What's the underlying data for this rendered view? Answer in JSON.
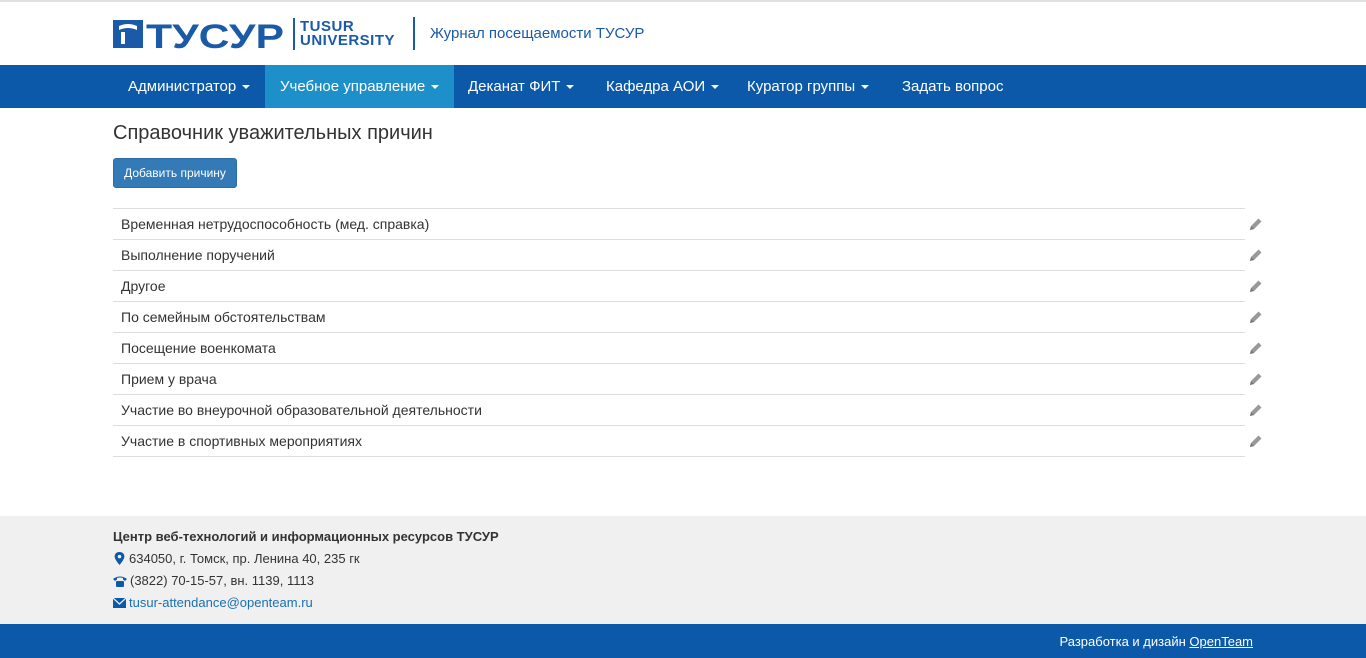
{
  "header": {
    "logo_text_line1": "TUSUR",
    "logo_text_line2": "UNIVERSITY",
    "logo_wordmark": "ТУСУР",
    "title": "Журнал посещаемости ТУСУР"
  },
  "nav": {
    "items": [
      {
        "label": "Администратор",
        "dropdown": true,
        "active": false
      },
      {
        "label": "Учебное управление",
        "dropdown": true,
        "active": true
      },
      {
        "label": "Деканат ФИТ",
        "dropdown": true,
        "active": false
      },
      {
        "label": "Кафедра АОИ",
        "dropdown": true,
        "active": false
      },
      {
        "label": "Куратор группы",
        "dropdown": true,
        "active": false
      },
      {
        "label": "Задать вопрос",
        "dropdown": false,
        "active": false
      }
    ]
  },
  "main": {
    "title": "Справочник уважительных причин",
    "add_button": "Добавить причину",
    "reasons": [
      "Временная нетрудоспособность (мед. справка)",
      "Выполнение поручений",
      "Другое",
      "По семейным обстоятельствам",
      "Посещение военкомата",
      "Прием у врача",
      "Участие во внеурочной образовательной деятельности",
      "Участие в спортивных мероприятиях"
    ],
    "row_icon": "pencil-icon"
  },
  "footer": {
    "org": "Центр веб-технологий и информационных ресурсов ТУСУР",
    "address": "634050, г. Томск, пр. Ленина 40, 235 гк",
    "phone": "(3822) 70-15-57, вн. 1139, 1113",
    "email": "tusur-attendance@openteam.ru",
    "dev_prefix": "Разработка и дизайн",
    "dev_link": "OpenTeam"
  },
  "colors": {
    "navbar": "#0b59a8",
    "nav_active": "#1e90c9",
    "brand": "#1a5aa8",
    "button": "#337ab7"
  }
}
